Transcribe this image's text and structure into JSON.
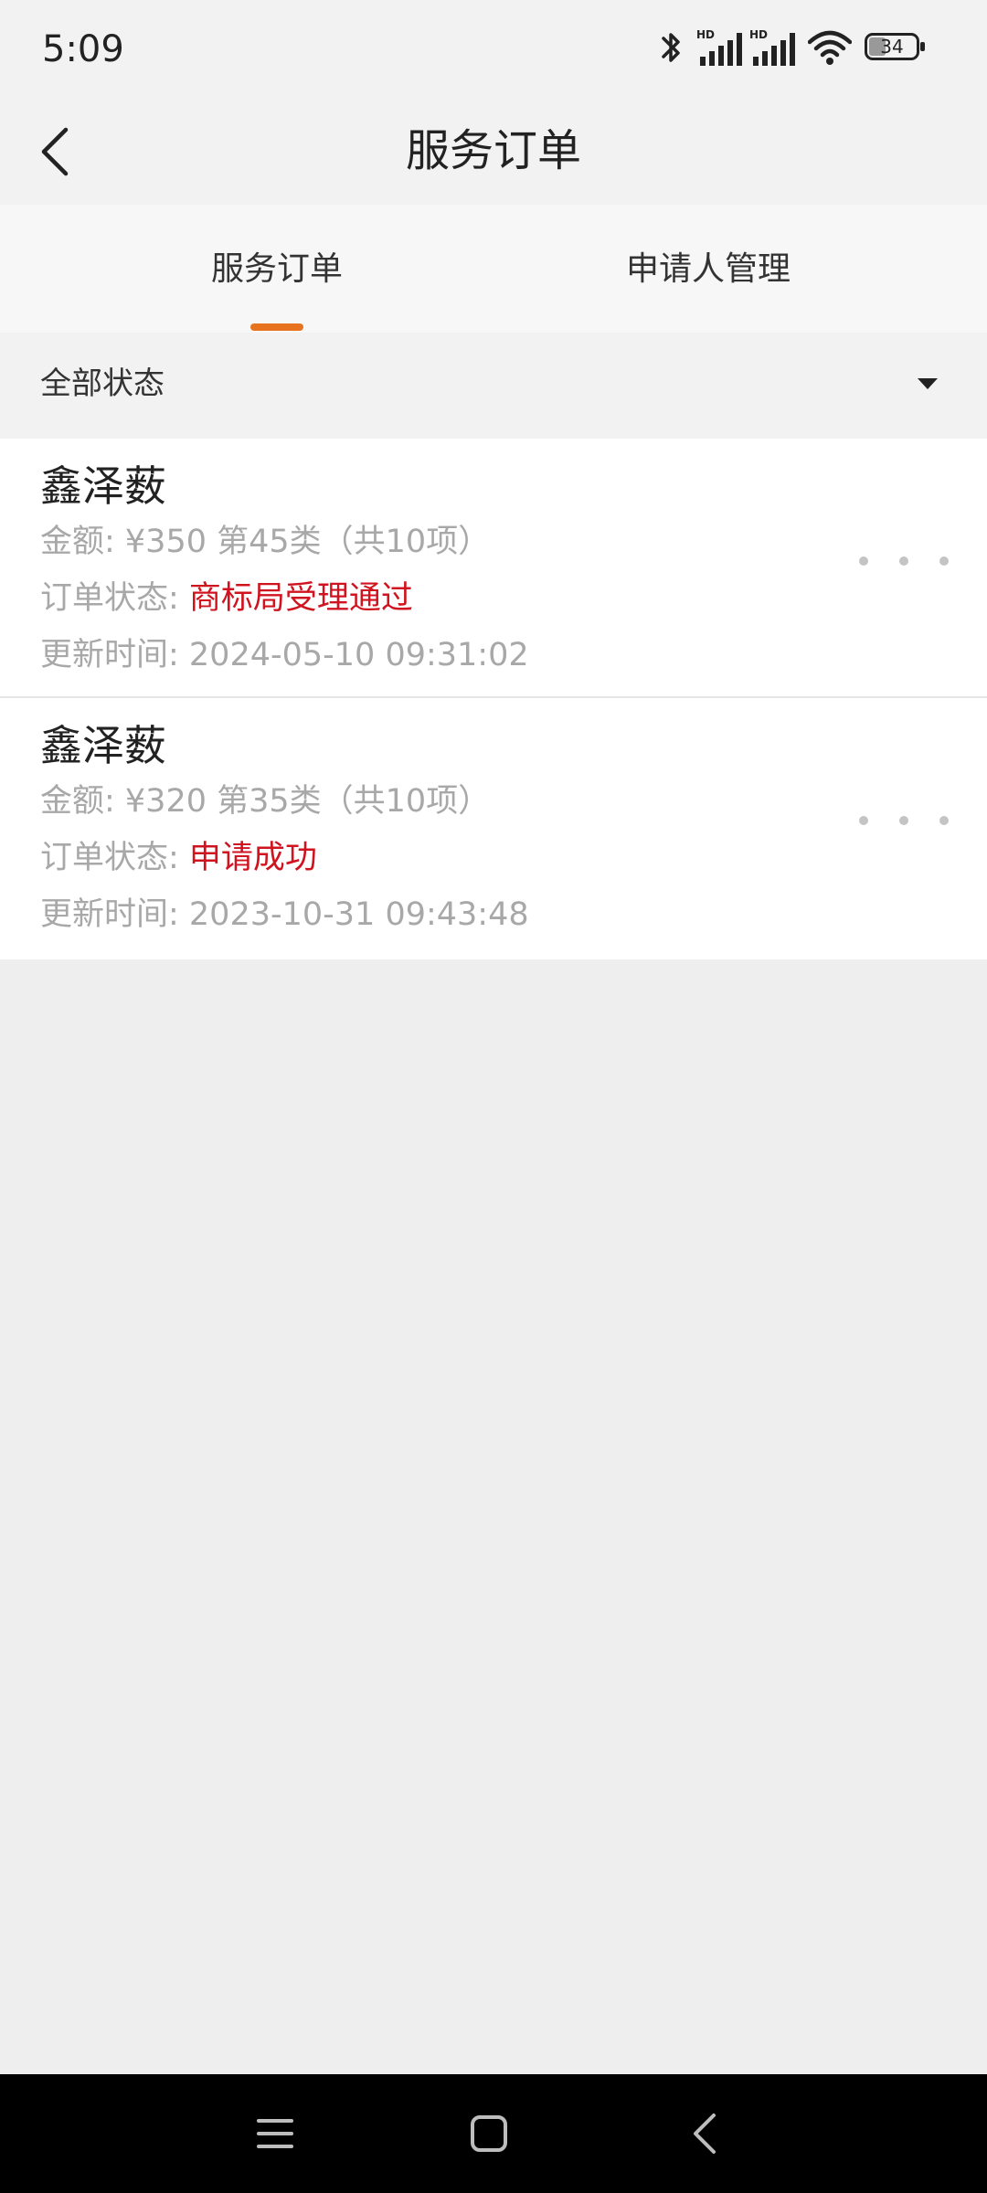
{
  "status_bar": {
    "time": "5:09",
    "battery": "34",
    "icons": [
      "bluetooth-icon",
      "signal-hd-icon",
      "signal-hd-icon",
      "wifi-icon",
      "battery-icon"
    ]
  },
  "header": {
    "title": "服务订单",
    "back_icon": "chevron-left-icon"
  },
  "tabs": [
    {
      "label": "服务订单",
      "active": true
    },
    {
      "label": "申请人管理",
      "active": false
    }
  ],
  "filter": {
    "selected": "全部状态",
    "icon": "caret-down-icon"
  },
  "orders": [
    {
      "name": "鑫泽薮",
      "amount_line": "金额: ¥350 第45类（共10项）",
      "status_label": "订单状态: ",
      "status_value": "商标局受理通过",
      "time_line": "更新时间: 2024-05-10 09:31:02"
    },
    {
      "name": "鑫泽薮",
      "amount_line": "金额: ¥320 第35类（共10项）",
      "status_label": "订单状态: ",
      "status_value": "申请成功",
      "time_line": "更新时间: 2023-10-31 09:43:48"
    }
  ],
  "colors": {
    "accent": "#e8731e",
    "status": "#d0141f",
    "muted_text": "#a8a8a8"
  },
  "nav_bar": {
    "icons": [
      "menu-icon",
      "home-icon",
      "back-icon"
    ]
  }
}
